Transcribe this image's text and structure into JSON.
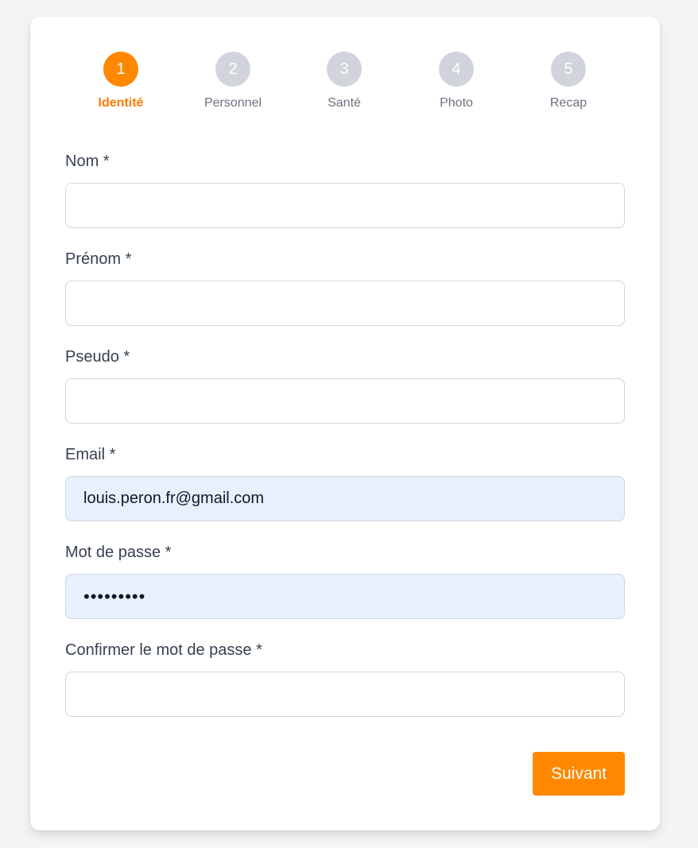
{
  "stepper": {
    "steps": [
      {
        "number": "1",
        "label": "Identité",
        "active": true
      },
      {
        "number": "2",
        "label": "Personnel",
        "active": false
      },
      {
        "number": "3",
        "label": "Santé",
        "active": false
      },
      {
        "number": "4",
        "label": "Photo",
        "active": false
      },
      {
        "number": "5",
        "label": "Recap",
        "active": false
      }
    ],
    "active_color": "#ff8800",
    "inactive_color": "#d1d5db"
  },
  "form": {
    "nom": {
      "label": "Nom *",
      "value": ""
    },
    "prenom": {
      "label": "Prénom *",
      "value": ""
    },
    "pseudo": {
      "label": "Pseudo *",
      "value": ""
    },
    "email": {
      "label": "Email *",
      "value": "louis.peron.fr@gmail.com"
    },
    "password": {
      "label": "Mot de passe *",
      "value": "•••••••••"
    },
    "confirm_password": {
      "label": "Confirmer le mot de passe *",
      "value": ""
    }
  },
  "actions": {
    "next_label": "Suivant"
  }
}
